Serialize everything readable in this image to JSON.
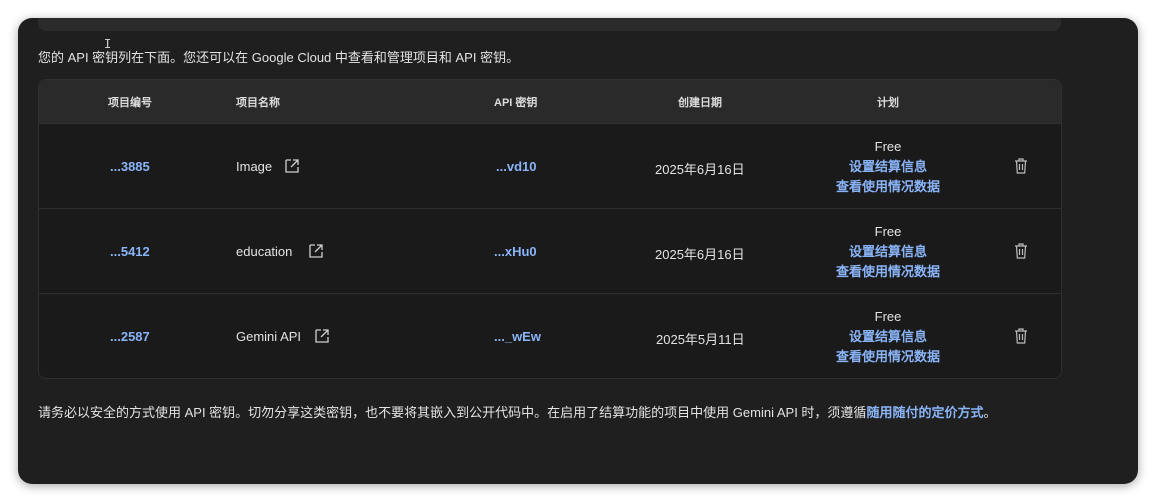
{
  "intro_text": "您的 API 密钥列在下面。您还可以在 Google Cloud 中查看和管理项目和 API 密钥。",
  "table": {
    "headers": {
      "project_number": "项目编号",
      "project_name": "项目名称",
      "api_key": "API 密钥",
      "created": "创建日期",
      "plan": "计划"
    },
    "rows": [
      {
        "project_number": "...3885",
        "project_name": "Image",
        "api_key": "...vd10",
        "created": "2025年6月16日",
        "plan": "Free",
        "billing_link": "设置结算信息",
        "usage_link": "查看使用情况数据"
      },
      {
        "project_number": "...5412",
        "project_name": "education",
        "api_key": "...xHu0",
        "created": "2025年6月16日",
        "plan": "Free",
        "billing_link": "设置结算信息",
        "usage_link": "查看使用情况数据"
      },
      {
        "project_number": "...2587",
        "project_name": "Gemini API",
        "api_key": "..._wEw",
        "created": "2025年5月11日",
        "plan": "Free",
        "billing_link": "设置结算信息",
        "usage_link": "查看使用情况数据"
      }
    ]
  },
  "footer": {
    "text": "请务必以安全的方式使用 API 密钥。切勿分享这类密钥，也不要将其嵌入到公开代码中。在启用了结算功能的项目中使用 Gemini API 时，须遵循",
    "link": "随用随付的定价方式",
    "suffix": "。"
  },
  "colors": {
    "background": "#1f1f1f",
    "accent_link": "#8ab4f8",
    "text": "#e3e3e3",
    "header_bg": "#2a2a2a"
  }
}
